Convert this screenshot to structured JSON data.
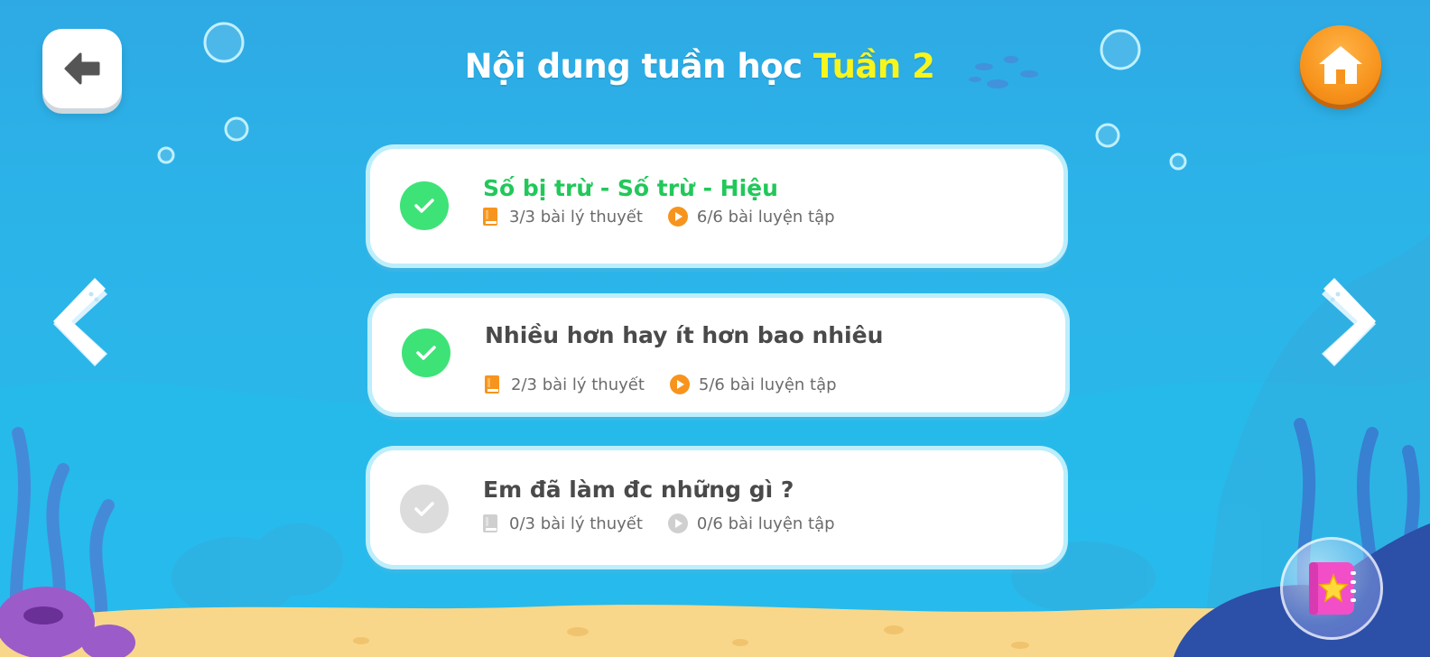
{
  "header": {
    "title_prefix": "Nội dung tuần học",
    "title_week": "Tuần 2"
  },
  "lessons": [
    {
      "title": "Số bị trừ - Số trừ - Hiệu",
      "status": "completed",
      "theory": "3/3 bài lý thuyết",
      "practice": "6/6 bài luyện tập"
    },
    {
      "title": "Nhiều hơn hay ít hơn bao nhiêu",
      "status": "completed",
      "theory": "2/3 bài lý thuyết",
      "practice": "5/6 bài luyện tập"
    },
    {
      "title": "Em đã làm đc những gì ?",
      "status": "not-started",
      "theory": "0/3 bài lý thuyết",
      "practice": "0/6 bài luyện tập"
    }
  ],
  "icons": {
    "back": "arrow-left-icon",
    "home": "home-icon",
    "prev": "chevron-left-icon",
    "next": "chevron-right-icon",
    "theory": "book-icon",
    "practice": "play-icon",
    "album": "star-notebook-icon"
  },
  "colors": {
    "accent_green": "#21c85a",
    "check_green": "#3de377",
    "orange": "#f7941d",
    "title_yellow": "#f6f51e",
    "inactive_gray": "#dcdcdc"
  }
}
